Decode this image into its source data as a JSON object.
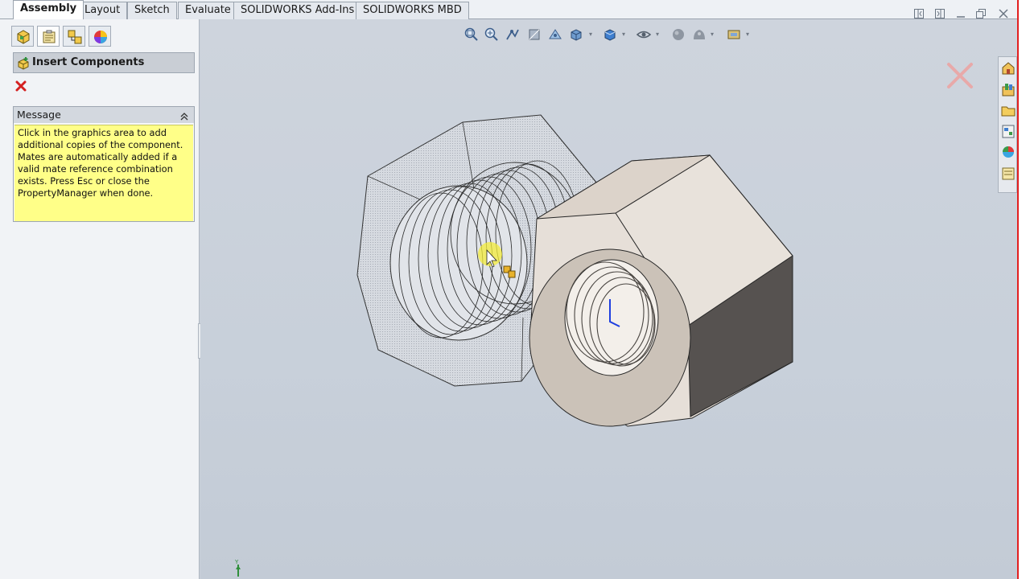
{
  "tabs": [
    {
      "label": "Assembly",
      "active": true
    },
    {
      "label": "Layout"
    },
    {
      "label": "Sketch"
    },
    {
      "label": "Evaluate"
    },
    {
      "label": "SOLIDWORKS Add-Ins"
    },
    {
      "label": "SOLIDWORKS MBD"
    }
  ],
  "property_manager": {
    "title": "Insert Components",
    "message_group": {
      "title": "Message",
      "text": "Click in the graphics area to add additional copies of the component. Mates are automatically added if a valid mate reference combination exists. Press Esc or close the PropertyManager when done."
    }
  },
  "icons": {
    "feature_manager_tabs": [
      "feature-manager-icon",
      "property-manager-icon",
      "configuration-manager-icon",
      "display-manager-icon"
    ],
    "heads_up_toolbar": [
      "zoom-to-fit-icon",
      "zoom-to-area-icon",
      "previous-view-icon",
      "section-view-icon",
      "dynamic-annotation-icon",
      "view-orientation-icon",
      "display-style-icon",
      "hide-show-items-icon",
      "edit-appearance-icon",
      "apply-scene-icon",
      "view-settings-icon"
    ],
    "task_pane": [
      "solidworks-resources-icon",
      "design-library-icon",
      "file-explorer-icon",
      "view-palette-icon",
      "appearances-icon",
      "custom-properties-icon"
    ]
  },
  "colors": {
    "accent_message_bg": "#ffff88",
    "cancel_red": "#d42020",
    "viewport_bg": "#c9d0da"
  }
}
